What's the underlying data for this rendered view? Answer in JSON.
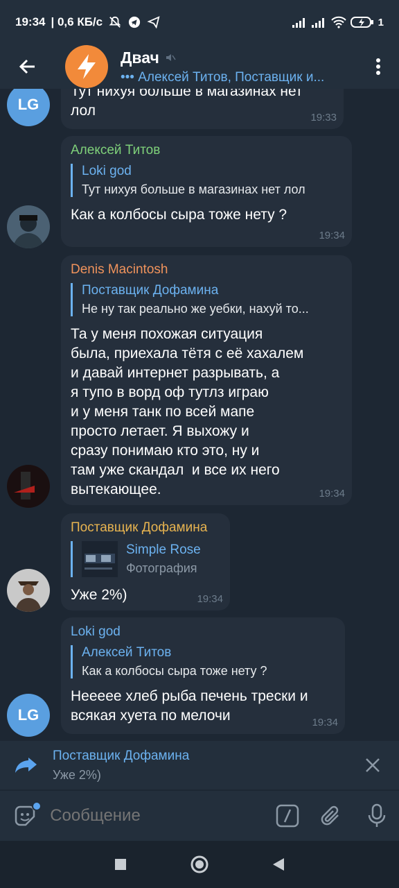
{
  "status_bar": {
    "time": "19:34",
    "speed": "| 0,6 КБ/с",
    "battery": "1"
  },
  "header": {
    "title": "Двач",
    "subtitle": "••• Алексей Титов, Поставщик и..."
  },
  "messages": [
    {
      "avatar": "LG",
      "text": "Тут нихуя больше в магазинах нет\nлол",
      "time": "19:33"
    },
    {
      "sender": "Алексей Титов",
      "sender_color": "#7fd17a",
      "reply_name": "Loki god",
      "reply_text": "Тут нихуя больше в магазинах нет лол",
      "text": "Как а колбосы сыра тоже нету ?",
      "time": "19:34"
    },
    {
      "sender": "Denis Macintosh",
      "sender_color": "#f0935c",
      "reply_name": "Поставщик Дофамина",
      "reply_text": "Не ну так реально же уебки, нахуй то...",
      "text": "Та у меня похожая ситуация\nбыла, приехала тётя с её хахалем\nи давай интернет разрывать, а\nя тупо в ворд оф тутлз играю\nи у меня танк по всей мапе\nпросто летает. Я выхожу и\nсразу понимаю кто это, ну и\nтам уже скандал  и все их него\nвытекающее.",
      "time": "19:34"
    },
    {
      "sender": "Поставщик Дофамина",
      "sender_color": "#e8b450",
      "reply_name": "Simple Rose",
      "reply_text": "Фотография",
      "text": "Уже 2%)",
      "time": "19:34"
    },
    {
      "sender": "Loki god",
      "sender_color": "#6cb2f0",
      "avatar": "LG",
      "reply_name": "Алексей Титов",
      "reply_text": "Как а колбосы сыра тоже нету ?",
      "text": "Неееее хлеб рыба печень трески и\nвсякая хуета по мелочи",
      "time": "19:34"
    }
  ],
  "reply_bar": {
    "name": "Поставщик Дофамина",
    "text": "Уже 2%)"
  },
  "input": {
    "placeholder": "Сообщение"
  }
}
